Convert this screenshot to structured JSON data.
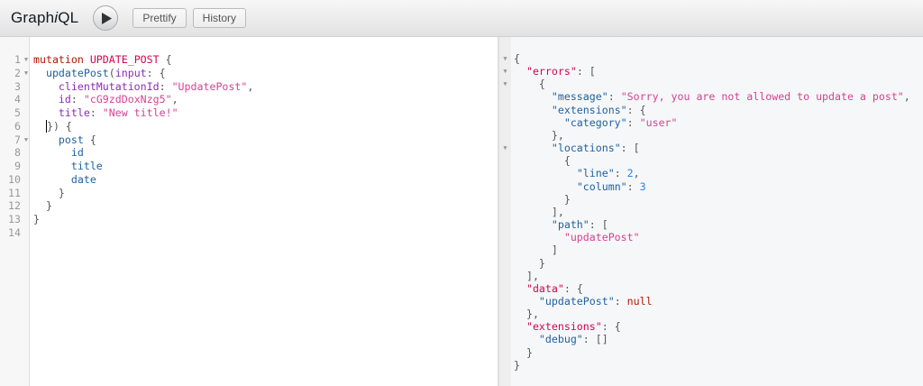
{
  "header": {
    "title_pre": "Graph",
    "title_i": "i",
    "title_post": "QL",
    "prettify": "Prettify",
    "history": "History"
  },
  "colors": {
    "keyword": "#B11A04",
    "def": "#D2054E",
    "property": "#1F61A0",
    "attribute": "#8B2BB9",
    "string": "#D64292",
    "number": "#2882F9"
  },
  "query": {
    "lines": [
      {
        "n": "1",
        "fold": true,
        "t": [
          [
            "kw",
            "mutation "
          ],
          [
            "def",
            "UPDATE_POST"
          ],
          [
            "p",
            " {"
          ]
        ]
      },
      {
        "n": "2",
        "fold": true,
        "t": [
          [
            "p",
            "  "
          ],
          [
            "prop",
            "updatePost"
          ],
          [
            "p",
            "("
          ],
          [
            "attr",
            "input"
          ],
          [
            "p",
            ": {"
          ]
        ]
      },
      {
        "n": "3",
        "t": [
          [
            "p",
            "    "
          ],
          [
            "attr",
            "clientMutationId"
          ],
          [
            "p",
            ": "
          ],
          [
            "str",
            "\"UpdatePost\""
          ],
          [
            "p",
            ","
          ]
        ]
      },
      {
        "n": "4",
        "t": [
          [
            "p",
            "    "
          ],
          [
            "attr",
            "id"
          ],
          [
            "p",
            ": "
          ],
          [
            "str",
            "\"cG9zdDoxNzg5\""
          ],
          [
            "p",
            ","
          ]
        ]
      },
      {
        "n": "5",
        "t": [
          [
            "p",
            "    "
          ],
          [
            "attr",
            "title"
          ],
          [
            "p",
            ": "
          ],
          [
            "str",
            "\"New title!\""
          ]
        ]
      },
      {
        "n": "6",
        "t": [
          [
            "p",
            "  "
          ],
          [
            "cursor",
            ""
          ],
          [
            "p",
            "}) {"
          ]
        ]
      },
      {
        "n": "7",
        "fold": true,
        "t": [
          [
            "p",
            "    "
          ],
          [
            "prop",
            "post"
          ],
          [
            "p",
            " {"
          ]
        ]
      },
      {
        "n": "8",
        "t": [
          [
            "p",
            "      "
          ],
          [
            "prop",
            "id"
          ]
        ]
      },
      {
        "n": "9",
        "t": [
          [
            "p",
            "      "
          ],
          [
            "prop",
            "title"
          ]
        ]
      },
      {
        "n": "10",
        "t": [
          [
            "p",
            "      "
          ],
          [
            "prop",
            "date"
          ]
        ]
      },
      {
        "n": "11",
        "t": [
          [
            "p",
            "    }"
          ]
        ]
      },
      {
        "n": "12",
        "t": [
          [
            "p",
            "  }"
          ]
        ]
      },
      {
        "n": "13",
        "t": [
          [
            "p",
            "}"
          ]
        ]
      },
      {
        "n": "14",
        "t": []
      }
    ]
  },
  "result": {
    "lines": [
      {
        "fold": true,
        "t": [
          [
            "p",
            "{"
          ]
        ]
      },
      {
        "fold": true,
        "t": [
          [
            "p",
            "  "
          ],
          [
            "def",
            "\"errors\""
          ],
          [
            "p",
            ": ["
          ]
        ]
      },
      {
        "fold": true,
        "t": [
          [
            "p",
            "    {"
          ]
        ]
      },
      {
        "t": [
          [
            "p",
            "      "
          ],
          [
            "prop",
            "\"message\""
          ],
          [
            "p",
            ": "
          ],
          [
            "str",
            "\"Sorry, you are not allowed to update a post\""
          ],
          [
            "p",
            ","
          ]
        ]
      },
      {
        "t": [
          [
            "p",
            "      "
          ],
          [
            "prop",
            "\"extensions\""
          ],
          [
            "p",
            ": {"
          ]
        ]
      },
      {
        "t": [
          [
            "p",
            "        "
          ],
          [
            "prop",
            "\"category\""
          ],
          [
            "p",
            ": "
          ],
          [
            "str",
            "\"user\""
          ]
        ]
      },
      {
        "t": [
          [
            "p",
            "      },"
          ]
        ]
      },
      {
        "fold": true,
        "t": [
          [
            "p",
            "      "
          ],
          [
            "prop",
            "\"locations\""
          ],
          [
            "p",
            ": ["
          ]
        ]
      },
      {
        "t": [
          [
            "p",
            "        {"
          ]
        ]
      },
      {
        "t": [
          [
            "p",
            "          "
          ],
          [
            "prop",
            "\"line\""
          ],
          [
            "p",
            ": "
          ],
          [
            "num2",
            "2"
          ],
          [
            "p",
            ","
          ]
        ]
      },
      {
        "t": [
          [
            "p",
            "          "
          ],
          [
            "prop",
            "\"column\""
          ],
          [
            "p",
            ": "
          ],
          [
            "num2",
            "3"
          ]
        ]
      },
      {
        "t": [
          [
            "p",
            "        }"
          ]
        ]
      },
      {
        "t": [
          [
            "p",
            "      ],"
          ]
        ]
      },
      {
        "t": [
          [
            "p",
            "      "
          ],
          [
            "prop",
            "\"path\""
          ],
          [
            "p",
            ": ["
          ]
        ]
      },
      {
        "t": [
          [
            "p",
            "        "
          ],
          [
            "str",
            "\"updatePost\""
          ]
        ]
      },
      {
        "t": [
          [
            "p",
            "      ]"
          ]
        ]
      },
      {
        "t": [
          [
            "p",
            "    }"
          ]
        ]
      },
      {
        "t": [
          [
            "p",
            "  ],"
          ]
        ]
      },
      {
        "t": [
          [
            "p",
            "  "
          ],
          [
            "def",
            "\"data\""
          ],
          [
            "p",
            ": {"
          ]
        ]
      },
      {
        "t": [
          [
            "p",
            "    "
          ],
          [
            "prop",
            "\"updatePost\""
          ],
          [
            "p",
            ": "
          ],
          [
            "kw",
            "null"
          ]
        ]
      },
      {
        "t": [
          [
            "p",
            "  },"
          ]
        ]
      },
      {
        "t": [
          [
            "p",
            "  "
          ],
          [
            "def",
            "\"extensions\""
          ],
          [
            "p",
            ": {"
          ]
        ]
      },
      {
        "t": [
          [
            "p",
            "    "
          ],
          [
            "prop",
            "\"debug\""
          ],
          [
            "p",
            ": []"
          ]
        ]
      },
      {
        "t": [
          [
            "p",
            "  }"
          ]
        ]
      },
      {
        "t": [
          [
            "p",
            "}"
          ]
        ]
      }
    ]
  }
}
